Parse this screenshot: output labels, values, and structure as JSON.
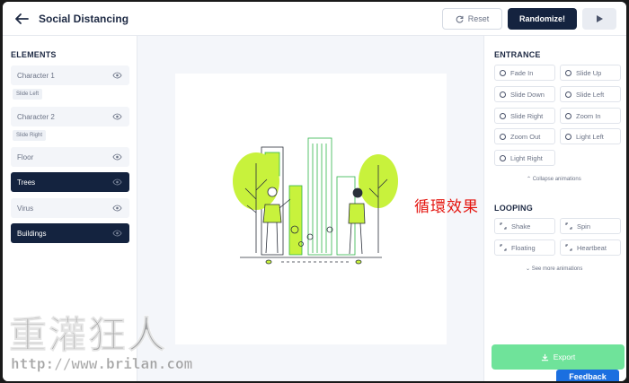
{
  "header": {
    "title": "Social Distancing",
    "reset_label": "Reset",
    "randomize_label": "Randomize!"
  },
  "elements": {
    "title": "ELEMENTS",
    "items": [
      {
        "label": "Character 1",
        "tag": "Slide Left",
        "active": false
      },
      {
        "label": "Character 2",
        "tag": "Slide Right",
        "active": false
      },
      {
        "label": "Floor",
        "tag": "",
        "active": false
      },
      {
        "label": "Trees",
        "tag": "",
        "active": true
      },
      {
        "label": "Virus",
        "tag": "",
        "active": false
      },
      {
        "label": "Buildings",
        "tag": "",
        "active": true
      }
    ]
  },
  "entrance": {
    "title": "ENTRANCE",
    "items": [
      "Fade In",
      "Slide Up",
      "Slide Down",
      "Slide Left",
      "Slide Right",
      "Zoom In",
      "Zoom Out",
      "Light Left",
      "Light Right"
    ],
    "collapse_label": "Collapse animations"
  },
  "looping": {
    "title": "LOOPING",
    "items": [
      "Shake",
      "Spin",
      "Floating",
      "Heartbeat"
    ],
    "more_label": "See more animations"
  },
  "export_label": "Export",
  "feedback_label": "Feedback",
  "annotation": "循環效果",
  "watermark": {
    "text": "重灌狂人",
    "url": "http://www.brilan.com"
  },
  "colors": {
    "navy": "#14233f",
    "accent_green": "#c8f23c",
    "export_green": "#6fe39a",
    "feedback_blue": "#1b6fe0"
  }
}
